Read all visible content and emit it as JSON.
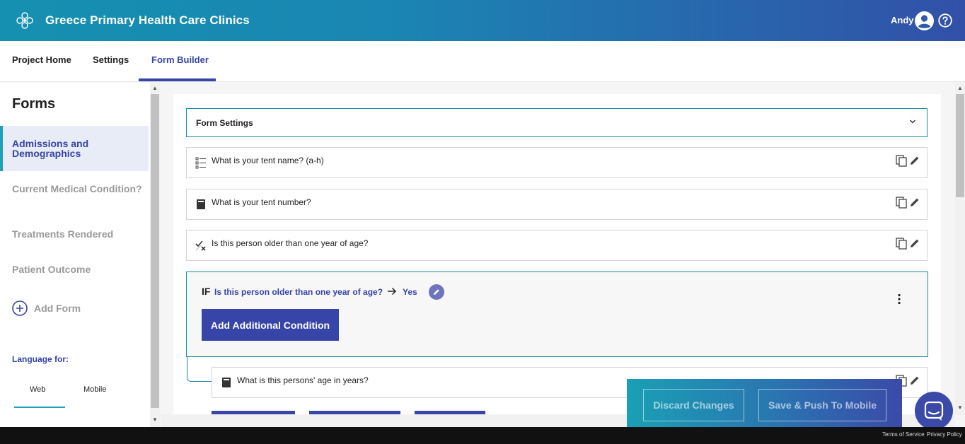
{
  "header": {
    "title": "Greece Primary Health Care Clinics",
    "user_name": "Andy"
  },
  "nav": {
    "tabs": [
      {
        "label": "Project Home"
      },
      {
        "label": "Settings"
      },
      {
        "label": "Form Builder",
        "active": true
      }
    ]
  },
  "sidebar": {
    "title": "Forms",
    "forms": [
      {
        "label": "Admissions and Demographics",
        "active": true
      },
      {
        "label": "Current Medical Condition?"
      },
      {
        "label": "Treatments Rendered"
      },
      {
        "label": "Patient Outcome"
      }
    ],
    "add_form_label": "Add Form",
    "language_label": "Language for:",
    "language_tabs": [
      {
        "label": "Web",
        "active": true
      },
      {
        "label": "Mobile"
      }
    ]
  },
  "builder": {
    "settings_label": "Form Settings",
    "questions": [
      {
        "text": "What is your tent name? (a-h)",
        "icon": "list-icon"
      },
      {
        "text": "What is your tent number?",
        "icon": "number-icon"
      },
      {
        "text": "Is this person older than one year of age?",
        "icon": "yes-no-icon"
      }
    ],
    "condition": {
      "if_label": "IF",
      "question": "Is this person older than one year of age?",
      "answer": "Yes",
      "add_condition_label": "Add Additional Condition"
    },
    "nested_question": {
      "text": "What is this persons' age in years?",
      "icon": "number-icon"
    }
  },
  "actions": {
    "discard_label": "Discard Changes",
    "save_label": "Save & Push To Mobile"
  },
  "footer": {
    "terms": "Terms of Service",
    "privacy": "Privacy Policy"
  },
  "colors": {
    "primary": "#3744a8",
    "accent": "#1fa1b8",
    "header_start": "#1590b0",
    "header_end": "#3250a8"
  }
}
